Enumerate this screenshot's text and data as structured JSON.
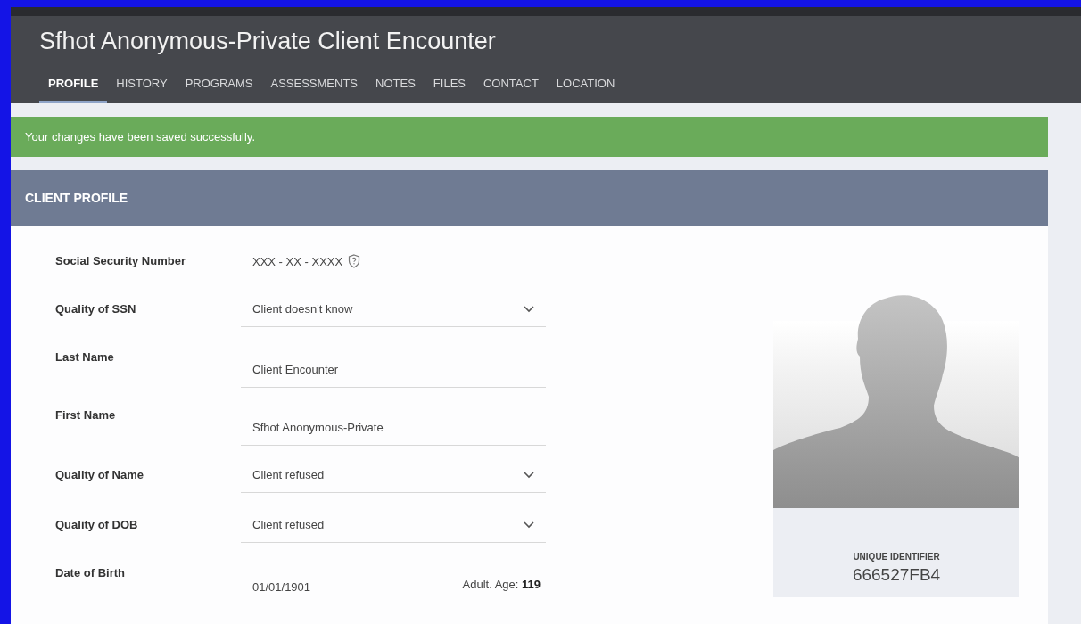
{
  "header": {
    "title": "Sfhot Anonymous-Private Client Encounter"
  },
  "tabs": [
    {
      "label": "PROFILE",
      "selected": true
    },
    {
      "label": "HISTORY",
      "selected": false
    },
    {
      "label": "PROGRAMS",
      "selected": false
    },
    {
      "label": "ASSESSMENTS",
      "selected": false
    },
    {
      "label": "NOTES",
      "selected": false
    },
    {
      "label": "FILES",
      "selected": false
    },
    {
      "label": "CONTACT",
      "selected": false
    },
    {
      "label": "LOCATION",
      "selected": false
    }
  ],
  "alert": {
    "kind": "success",
    "message": "Your changes have been saved successfully."
  },
  "section": {
    "title": "CLIENT PROFILE"
  },
  "fields": [
    {
      "kind": "masked",
      "label": "Social Security Number",
      "value": "XXX - XX - XXXX"
    },
    {
      "kind": "select",
      "label": "Quality of SSN",
      "value": "Client doesn't know"
    },
    {
      "kind": "input",
      "label": "Last Name",
      "value": "Client Encounter"
    },
    {
      "kind": "input",
      "label": "First Name",
      "value": "Sfhot Anonymous-Private"
    },
    {
      "kind": "select",
      "label": "Quality of Name",
      "value": "Client refused"
    },
    {
      "kind": "select",
      "label": "Quality of DOB",
      "value": "Client refused"
    },
    {
      "kind": "date",
      "label": "Date of Birth",
      "value": "01/01/1901",
      "note": "Adult. Age: **119**"
    }
  ],
  "identifier": {
    "label": "UNIQUE IDENTIFIER",
    "value": "666527FB4"
  }
}
